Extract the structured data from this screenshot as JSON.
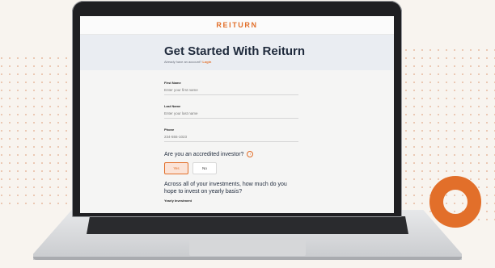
{
  "app": {
    "logo": "REITURN",
    "title": "Get Started With Reiturn",
    "have_account_text": "Already have an account?",
    "login_link": "Login"
  },
  "form": {
    "first_name": {
      "label": "First Name",
      "placeholder": "Enter your first name"
    },
    "last_name": {
      "label": "Last Name",
      "placeholder": "Enter your last name"
    },
    "phone": {
      "label": "Phone",
      "placeholder": "234-555-1023"
    },
    "accredited_question": "Are you an accredited investor?",
    "yes_label": "Yes",
    "no_label": "No",
    "investment_question": "Across all of your investments, how much do you hope to invest on yearly basis?",
    "yearly_investment_label": "Yearly Investment"
  },
  "colors": {
    "accent": "#e26f2a",
    "background": "#f8f4ef"
  }
}
